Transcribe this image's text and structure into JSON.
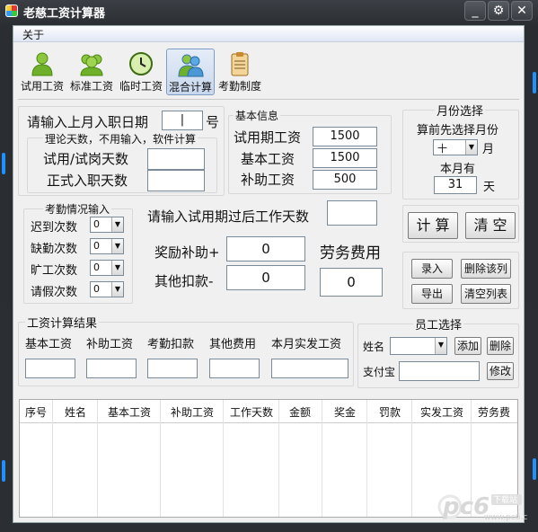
{
  "window": {
    "title": "老慈工资计算器",
    "buttons": [
      "_",
      "⚙",
      "✕"
    ]
  },
  "menu": {
    "about": "关于"
  },
  "toolbar": [
    {
      "label": "试用工资",
      "icon": "person-icon"
    },
    {
      "label": "标准工资",
      "icon": "group-icon"
    },
    {
      "label": "临时工资",
      "icon": "clock-icon"
    },
    {
      "label": "混合计算",
      "icon": "people-icon"
    },
    {
      "label": "考勤制度",
      "icon": "clipboard-icon"
    }
  ],
  "entry": {
    "prompt": "请输入上月入职日期",
    "day_value": "|",
    "day_suffix": "号",
    "theory_title": "理论天数，不用输入，软件计算",
    "trial_days_label": "试用/试岗天数",
    "formal_days_label": "正式入职天数"
  },
  "basic": {
    "title": "基本信息",
    "trial_wage_label": "试用期工资",
    "trial_wage_value": "1500",
    "base_wage_label": "基本工资",
    "base_wage_value": "1500",
    "subsidy_label": "补助工资",
    "subsidy_value": "500"
  },
  "month": {
    "title": "月份选择",
    "hint": "算前先选择月份",
    "month_value": "十",
    "month_suffix": "月",
    "days_label": "本月有",
    "days_value": "31",
    "days_suffix": "天"
  },
  "attendance": {
    "title": "考勤情况输入",
    "rows": [
      {
        "label": "迟到次数",
        "value": "0"
      },
      {
        "label": "缺勤次数",
        "value": "0"
      },
      {
        "label": "旷工次数",
        "value": "0"
      },
      {
        "label": "请假次数",
        "value": "0"
      }
    ]
  },
  "post_trial": {
    "label": "请输入试用期过后工作天数"
  },
  "bonus": {
    "label": "奖励补助+",
    "value": "0"
  },
  "deduct": {
    "label": "其他扣款-",
    "value": "0"
  },
  "labor": {
    "label": "劳务费用",
    "value": "0"
  },
  "actions": {
    "calc": "计 算",
    "clear": "清 空",
    "record": "录入",
    "delete_col": "删除该列",
    "export": "导出",
    "clear_list": "清空列表"
  },
  "result": {
    "title": "工资计算结果",
    "fields": [
      "基本工资",
      "补助工资",
      "考勤扣款",
      "其他费用",
      "本月实发工资"
    ]
  },
  "employee": {
    "title": "员工选择",
    "name_label": "姓名",
    "add": "添加",
    "delete": "删除",
    "alipay_label": "支付宝",
    "modify": "修改"
  },
  "table": {
    "columns": [
      "序号",
      "姓名",
      "基本工资",
      "补助工资",
      "工作天数",
      "金额",
      "奖金",
      "罚款",
      "实发工资",
      "劳务费"
    ]
  },
  "watermark": {
    "text": "pc6",
    "sub": "下载站",
    "url": "www.pc6.com"
  },
  "colors": {
    "frame": "#2b2e33",
    "accent": "#1e90ff",
    "client": "#f0f0f0"
  }
}
